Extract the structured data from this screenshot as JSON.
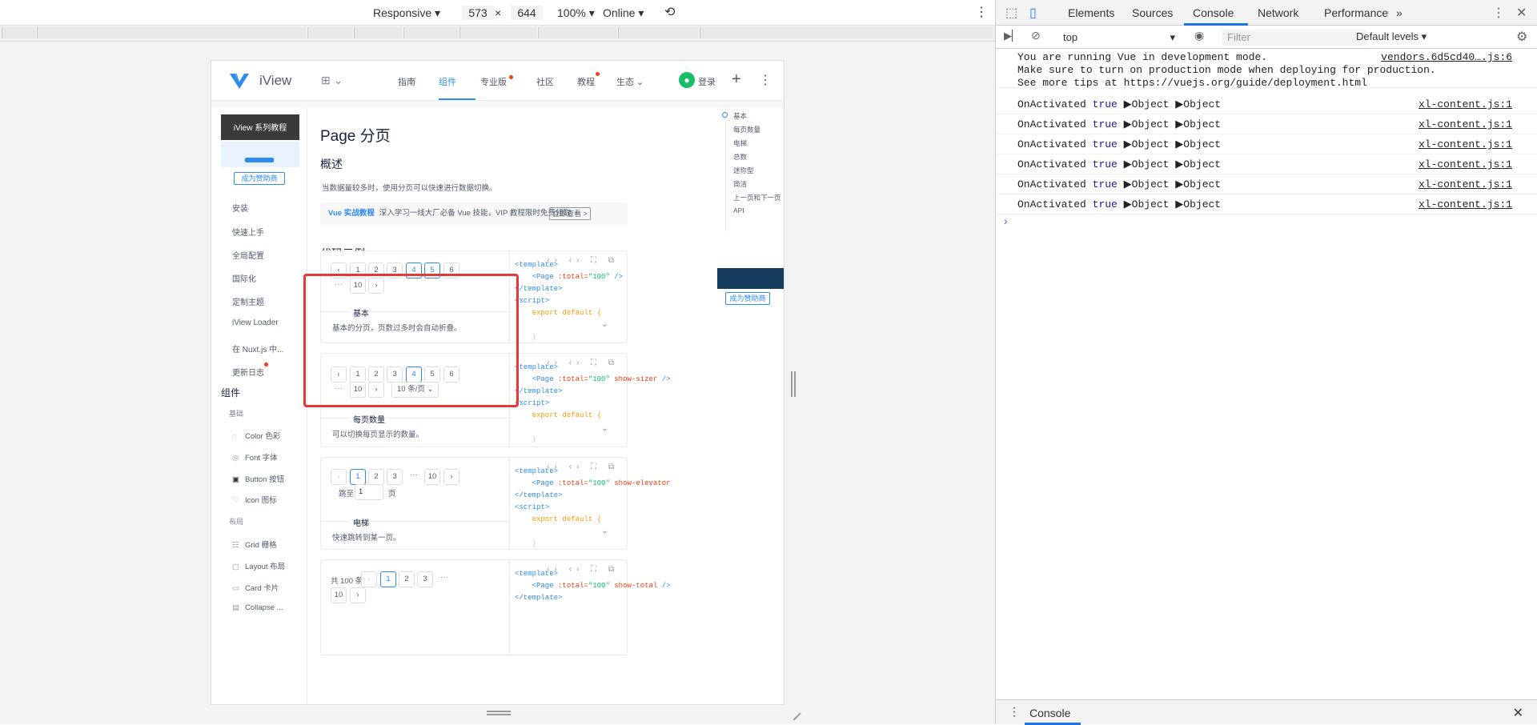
{
  "device_toolbar": {
    "mode": "Responsive",
    "width": "573",
    "times": "×",
    "height": "644",
    "zoom": "100%",
    "network": "Online"
  },
  "iview": {
    "brand": "iView",
    "nav": [
      "指南",
      "组件",
      "专业版",
      "社区",
      "教程",
      "生态"
    ],
    "active_nav": "组件",
    "login": "登录",
    "sidebar": {
      "ad_title": "iView 系列教程",
      "sponsor": "成为赞助商",
      "items": [
        "安装",
        "快速上手",
        "全局配置",
        "国际化",
        "定制主题",
        "iView Loader",
        "在 Nuxt.js 中...",
        "更新日志"
      ],
      "group": "组件",
      "sub_basic": "基础",
      "basic_items": [
        "Color 色彩",
        "Font 字体",
        "Button 按钮",
        "Icon 图标"
      ],
      "sub_layout": "布局",
      "layout_items": [
        "Grid 栅格",
        "Layout 布局",
        "Card 卡片",
        "Collapse ..."
      ]
    },
    "content": {
      "title": "Page 分页",
      "overview": "概述",
      "overview_desc": "当数据量较多时，使用分页可以快速进行数据切换。",
      "banner_brand": "Vue 实战教程",
      "banner_text": "深入学习一线大厂必备 Vue 技能，VIP 教程限时免费领取",
      "banner_btn": "立即查看 >",
      "examples_title": "代码示例",
      "demos": [
        {
          "title": "基本",
          "desc": "基本的分页，页数过多时会自动折叠。",
          "attr": "",
          "pages": [
            "1",
            "2",
            "3",
            "4",
            "5",
            "6"
          ],
          "last": "10"
        },
        {
          "title": "每页数量",
          "desc": "可以切换每页显示的数量。",
          "attr": "show-sizer",
          "pages": [
            "1",
            "2",
            "3",
            "4",
            "5",
            "6"
          ],
          "last": "10",
          "sizer": "10 条/页"
        },
        {
          "title": "电梯",
          "desc": "快速跳转到某一页。",
          "attr": "show-elevator",
          "pages": [
            "1",
            "2",
            "3"
          ],
          "last": "10",
          "jump_label": "跳至",
          "jump_value": "1",
          "jump_unit": "页"
        },
        {
          "title": "",
          "desc": "",
          "attr": "show-total",
          "total": "共 100 条",
          "pages": [
            "1",
            "2",
            "3"
          ],
          "last": "10"
        }
      ],
      "code": {
        "template_open": "<template>",
        "page_open": "<Page",
        "total_attr": ":total=",
        "total_val": "\"100\"",
        "close": "/>",
        "template_close": "</template>",
        "script_open": "<script>",
        "export": "export default {",
        "brace": "}"
      },
      "anchors": [
        "基本",
        "每页数量",
        "电梯",
        "总数",
        "迷你型",
        "简洁",
        "上一页和下一页",
        "API"
      ]
    }
  },
  "devtools": {
    "tabs": [
      "Elements",
      "Sources",
      "Console",
      "Network",
      "Performance"
    ],
    "selected_tab": "Console",
    "context": "top",
    "filter_placeholder": "Filter",
    "levels": "Default levels",
    "messages": [
      {
        "lines": [
          "You are running Vue in development mode.",
          "Make sure to turn on production mode when deploying for production.",
          "See more tips at https://vuejs.org/guide/deployment.html"
        ],
        "source": "vendors.6d5cd40….js:6"
      },
      {
        "text": "OnActivated",
        "value": "true",
        "obj1": "Object",
        "obj2": "Object",
        "source": "xl-content.js:1"
      },
      {
        "text": "OnActivated",
        "value": "true",
        "obj1": "Object",
        "obj2": "Object",
        "source": "xl-content.js:1"
      },
      {
        "text": "OnActivated",
        "value": "true",
        "obj1": "Object",
        "obj2": "Object",
        "source": "xl-content.js:1"
      },
      {
        "text": "OnActivated",
        "value": "true",
        "obj1": "Object",
        "obj2": "Object",
        "source": "xl-content.js:1"
      },
      {
        "text": "OnActivated",
        "value": "true",
        "obj1": "Object",
        "obj2": "Object",
        "source": "xl-content.js:1"
      },
      {
        "text": "OnActivated",
        "value": "true",
        "obj1": "Object",
        "obj2": "Object",
        "source": "xl-content.js:1"
      }
    ],
    "drawer_tab": "Console"
  },
  "colors": {
    "accent": "#2d8cf0",
    "highlight_box": "#e53935",
    "devtools_blue": "#1a73e8"
  }
}
